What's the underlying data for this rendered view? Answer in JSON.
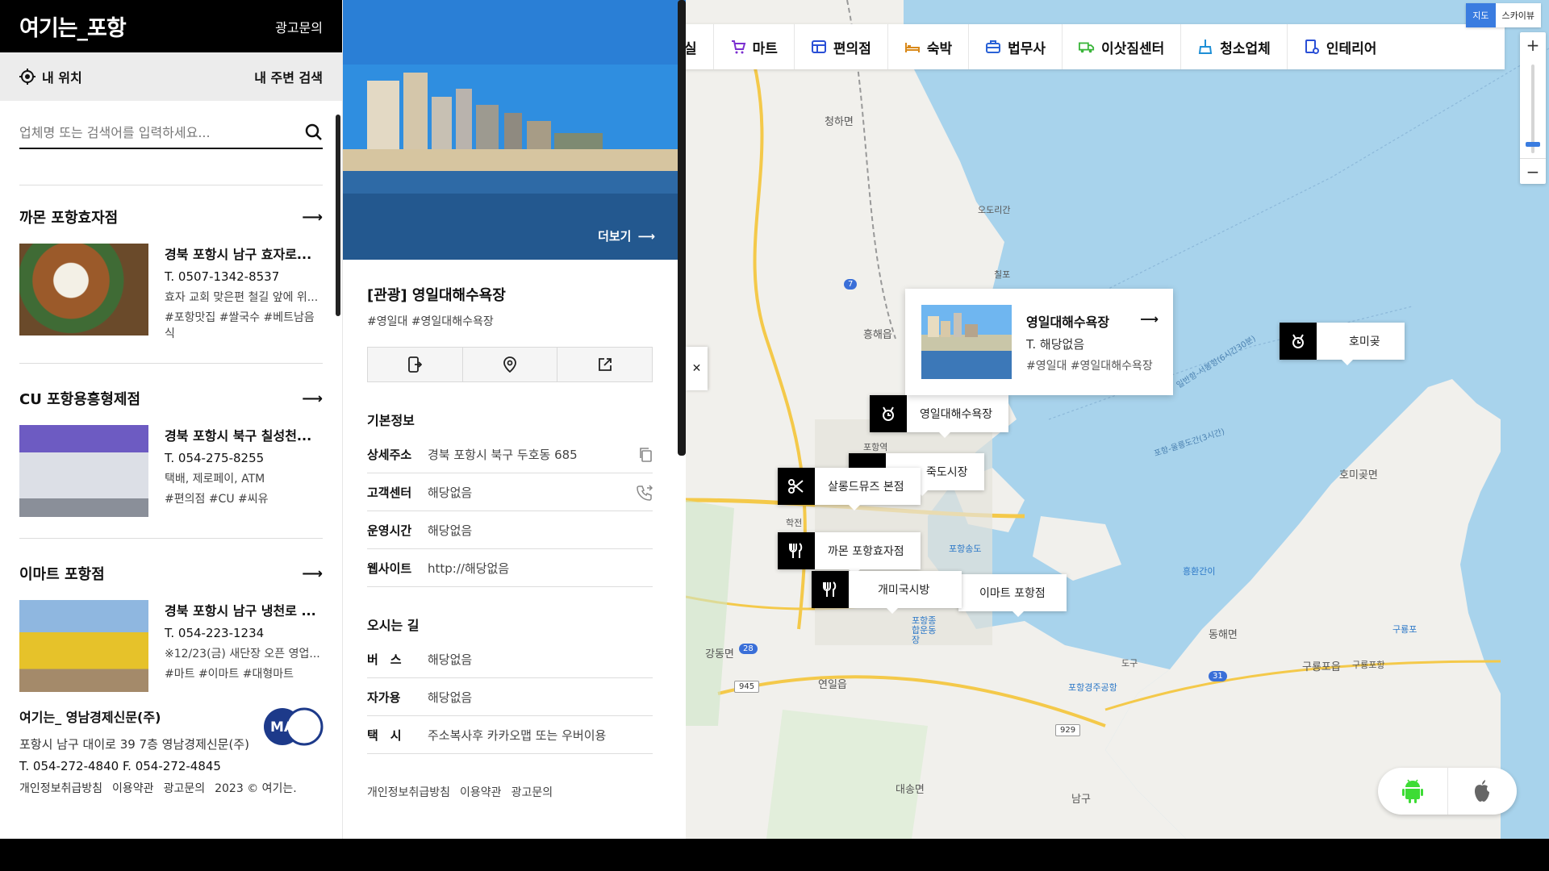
{
  "brand": {
    "logo": "여기는_포항",
    "ad_link": "광고문의"
  },
  "location_bar": {
    "my_location": "내 위치",
    "nearby_search": "내 주변 검색"
  },
  "search": {
    "placeholder": "업체명 또는 검색어를 입력하세요..."
  },
  "list": [
    {
      "name": "까몬 포항효자점",
      "address": "경북 포항시 남구 효자로...",
      "tel": "T. 0507-1342-8537",
      "desc": "효자 교회 맞은편 철길 앞에 위...",
      "tags": "#포항맛집 #쌀국수 #베트남음식"
    },
    {
      "name": "CU 포항용흥형제점",
      "address": "경북 포항시 북구 칠성천...",
      "tel": "T. 054-275-8255",
      "desc": "택배, 제로페이, ATM",
      "tags": "#편의점 #CU #씨유"
    },
    {
      "name": "이마트 포항점",
      "address": "경북 포항시 남구 냉천로 ...",
      "tel": "T. 054-223-1234",
      "desc": "※12/23(금) 새단장 오픈 영업...",
      "tags": "#마트 #이마트 #대형마트"
    }
  ],
  "footer": {
    "company": "여기는_ 영남경제신문(주)",
    "address": "포항시 남구 대이로 39 7층 영남경제신문(주)",
    "tel": "T. 054-272-4840 F. 054-272-4845",
    "links": [
      "개인정보취급방침",
      "이용약관",
      "광고문의",
      "2023 © 여기는."
    ],
    "logo_text": "MA"
  },
  "detail": {
    "more": "더보기",
    "title": "[관광] 영일대해수욕장",
    "tags": "#영일대 #영일대해수욕장",
    "basic_heading": "기본정보",
    "basic": [
      {
        "k": "상세주소",
        "v": "경북 포항시 북구 두호동 685"
      },
      {
        "k": "고객센터",
        "v": "해당없음"
      },
      {
        "k": "운영시간",
        "v": "해당없음"
      },
      {
        "k": "웹사이트",
        "v": "http://해당없음"
      }
    ],
    "route_heading": "오시는 길",
    "route": [
      {
        "k": "버　스",
        "v": "해당없음"
      },
      {
        "k": "자가용",
        "v": "해당없음"
      },
      {
        "k": "택　시",
        "v": "주소복사후 카카오맵 또는 우버이용"
      }
    ],
    "footer_links": [
      "개인정보취급방침",
      "이용약관",
      "광고문의"
    ]
  },
  "categories": [
    {
      "label": "실",
      "icon": "partial-icon",
      "color": "#333333"
    },
    {
      "label": "마트",
      "icon": "cart-icon",
      "color": "#7b2fd0"
    },
    {
      "label": "편의점",
      "icon": "store-icon",
      "color": "#2a4fd6"
    },
    {
      "label": "숙박",
      "icon": "bed-icon",
      "color": "#d9891a"
    },
    {
      "label": "법무사",
      "icon": "briefcase-icon",
      "color": "#2a62d6"
    },
    {
      "label": "이삿짐센터",
      "icon": "truck-icon",
      "color": "#3bb53b"
    },
    {
      "label": "청소업체",
      "icon": "broom-icon",
      "color": "#1e8fd6"
    },
    {
      "label": "인테리어",
      "icon": "paint-icon",
      "color": "#2a4fd6"
    }
  ],
  "map_type": {
    "map": "지도",
    "skyview": "스카이뷰"
  },
  "popup": {
    "title": "영일대해수욕장",
    "tel": "T. 해당없음",
    "tags": "#영일대 #영일대해수욕장"
  },
  "markers": [
    {
      "label": "영일대해수욕장",
      "icon": "tourism-icon"
    },
    {
      "label": "호미곶",
      "icon": "tourism-icon"
    },
    {
      "label": "죽도시장",
      "icon": "tourism-icon"
    },
    {
      "label": "살롱드뮤즈 본점",
      "icon": "scissors-icon"
    },
    {
      "label": "까몬 포항효자점",
      "icon": "restaurant-icon"
    },
    {
      "label": "개미국시방",
      "icon": "restaurant-icon"
    },
    {
      "label": "이마트 포항점",
      "icon": ""
    }
  ],
  "map_labels": [
    "청하면",
    "오도리간",
    "칠포",
    "흥해읍",
    "포항역",
    "학전",
    "포항송도",
    "포항종합운동장",
    "강동면",
    "연일읍",
    "대송면",
    "남구",
    "동해면",
    "호미곶면",
    "구룡포읍",
    "구룡포항",
    "도구",
    "포항경주공항",
    "흥환간이",
    "구룡포",
    "일반항-서봉항(6시간30분)",
    "포항-울릉도간(3시간)"
  ],
  "road_badges": [
    "7",
    "28",
    "31",
    "929",
    "945"
  ],
  "app_store": {
    "android": "android-icon",
    "apple": "apple-icon"
  }
}
